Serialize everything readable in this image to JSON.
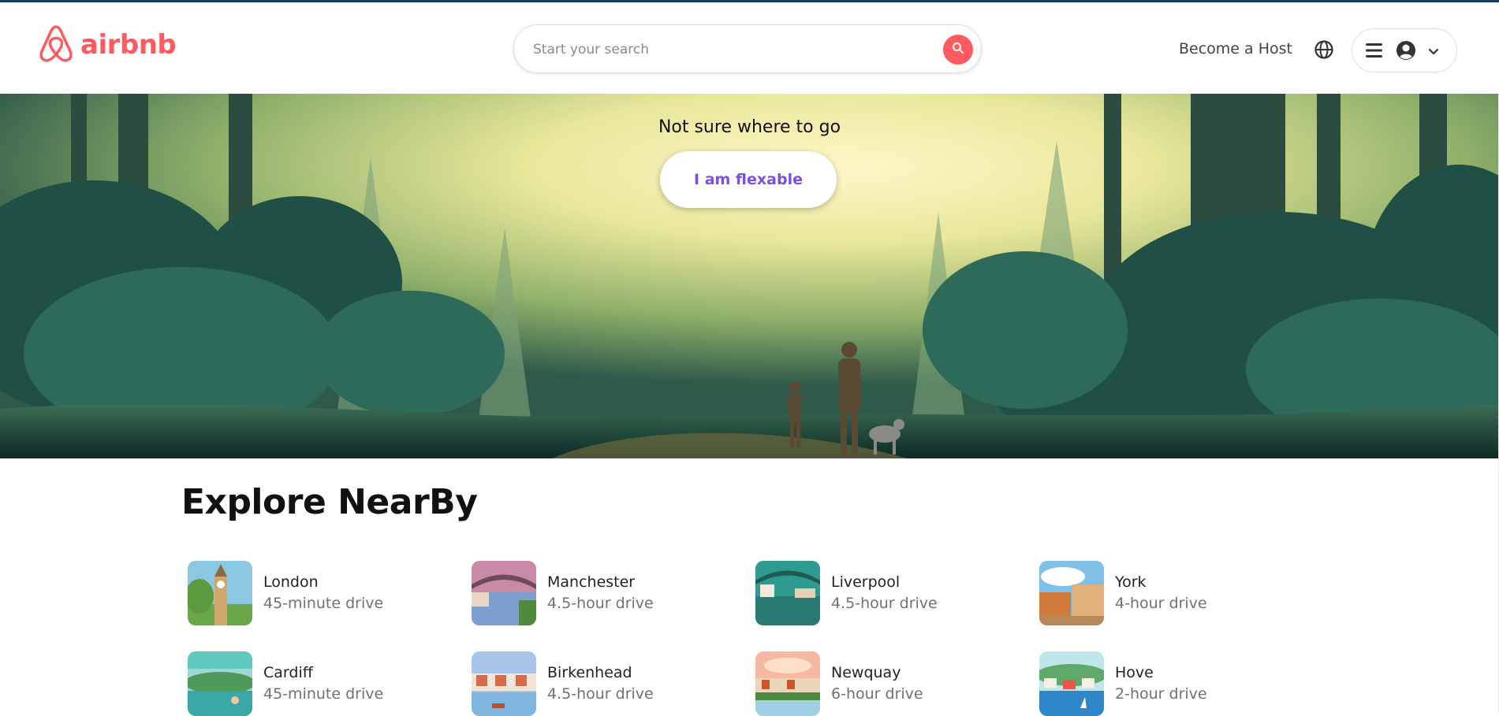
{
  "header": {
    "logo_text": "airbnb",
    "search_placeholder": "Start your search",
    "become_host": "Become a Host"
  },
  "hero": {
    "caption": "Not sure where to go",
    "button_label": "I am flexable"
  },
  "explore": {
    "title": "Explore NearBy",
    "items": [
      {
        "city": "London",
        "drive": "45-minute drive"
      },
      {
        "city": "Manchester",
        "drive": "4.5-hour drive"
      },
      {
        "city": "Liverpool",
        "drive": "4.5-hour drive"
      },
      {
        "city": "York",
        "drive": "4-hour drive"
      },
      {
        "city": "Cardiff",
        "drive": "45-minute drive"
      },
      {
        "city": "Birkenhead",
        "drive": "4.5-hour drive"
      },
      {
        "city": "Newquay",
        "drive": "6-hour drive"
      },
      {
        "city": "Hove",
        "drive": "2-hour drive"
      }
    ]
  },
  "colors": {
    "brand": "#ff5a5f",
    "flex_button_text": "#7b4fe0"
  },
  "icons": [
    "airbnb-logo-icon",
    "search-icon",
    "globe-icon",
    "menu-icon",
    "user-avatar-icon",
    "chevron-down-icon"
  ]
}
